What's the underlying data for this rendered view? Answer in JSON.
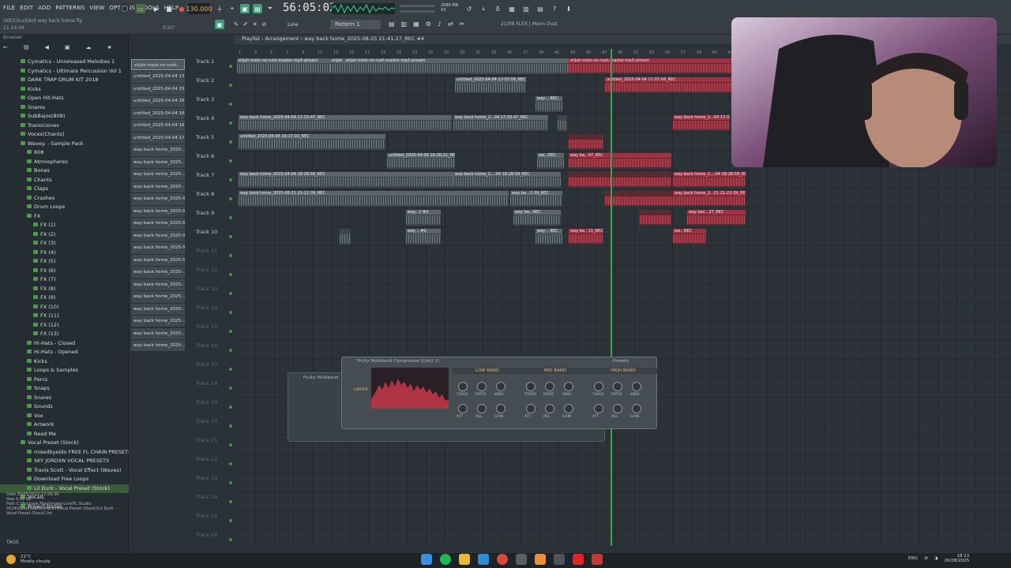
{
  "menu": {
    "items": [
      "FILE",
      "EDIT",
      "ADD",
      "PATTERNS",
      "VIEW",
      "OPTIONS",
      "TOOLS",
      "HELP"
    ],
    "hint": "(Alt)Cloud|Aid way back home.flp",
    "hint_time": "11:14:06",
    "position": "0'20\""
  },
  "transport": {
    "tempo": "130.000",
    "time": "56:05:03",
    "cpu_line1": "2689 MB",
    "cpu_line2": "43",
    "pattern": "Pattern 1",
    "plugin_info": "21/08  FLEX | Moon Dust",
    "snap": "Line"
  },
  "browser": {
    "header": "Browser",
    "items": [
      {
        "label": "Cymatics - Unreleased Melodies 1",
        "indent": 0
      },
      {
        "label": "Cymatics - Ultimate Percussion Vol 1",
        "indent": 0
      },
      {
        "label": "DARK TRAP DRUM KIT 2018",
        "indent": 0
      },
      {
        "label": "Kicks",
        "indent": 0
      },
      {
        "label": "Open Hit-Hats",
        "indent": 0
      },
      {
        "label": "Snares",
        "indent": 0
      },
      {
        "label": "SubBajos(808)",
        "indent": 0
      },
      {
        "label": "Transiciones",
        "indent": 0
      },
      {
        "label": "Voces(Chants)",
        "indent": 0
      },
      {
        "label": "Wavey. - Sample Pack",
        "indent": 0
      },
      {
        "label": "808",
        "indent": 1
      },
      {
        "label": "Atmospheres",
        "indent": 1
      },
      {
        "label": "Bones",
        "indent": 1
      },
      {
        "label": "Chants",
        "indent": 1
      },
      {
        "label": "Claps",
        "indent": 1
      },
      {
        "label": "Crashes",
        "indent": 1
      },
      {
        "label": "Drum Loops",
        "indent": 1
      },
      {
        "label": "FX",
        "indent": 1
      },
      {
        "label": "FX (1)",
        "indent": 2
      },
      {
        "label": "FX (2)",
        "indent": 2
      },
      {
        "label": "FX (3)",
        "indent": 2
      },
      {
        "label": "FX (4)",
        "indent": 2
      },
      {
        "label": "FX (5)",
        "indent": 2
      },
      {
        "label": "FX (6)",
        "indent": 2
      },
      {
        "label": "FX (7)",
        "indent": 2
      },
      {
        "label": "FX (8)",
        "indent": 2
      },
      {
        "label": "FX (9)",
        "indent": 2
      },
      {
        "label": "FX (10)",
        "indent": 2
      },
      {
        "label": "FX (11)",
        "indent": 2
      },
      {
        "label": "FX (12)",
        "indent": 2
      },
      {
        "label": "FX (13)",
        "indent": 2
      },
      {
        "label": "Hi-Hats - Closed",
        "indent": 1
      },
      {
        "label": "Hi-Hats - Opened",
        "indent": 1
      },
      {
        "label": "Kicks",
        "indent": 1
      },
      {
        "label": "Loops & Samples",
        "indent": 1
      },
      {
        "label": "Percs",
        "indent": 1
      },
      {
        "label": "Snaps",
        "indent": 1
      },
      {
        "label": "Snares",
        "indent": 1
      },
      {
        "label": "Sounds",
        "indent": 1
      },
      {
        "label": "Vox",
        "indent": 1
      },
      {
        "label": "Artwork",
        "indent": 1
      },
      {
        "label": "Read Me",
        "indent": 1
      },
      {
        "label": "Vocal Preset (Stock)",
        "indent": 0
      },
      {
        "label": "misedbyeldo FREE FL CHAIN PRESETS VOL. 2",
        "indent": 1
      },
      {
        "label": "SKY JORDXN VOCAL PRESETS",
        "indent": 1
      },
      {
        "label": "Travis Scott - Vocal Effect (Waves)",
        "indent": 1
      },
      {
        "label": "Download Free Loops",
        "indent": 1
      },
      {
        "label": "Lil Durk - Vocal Preset (Stock)",
        "indent": 1
      },
      {
        "label": "Vocals",
        "indent": 0
      },
      {
        "label": "Project bones",
        "indent": 0
      }
    ],
    "info": [
      "Date   30/05/2022 17:29:36",
      "Size   4.59 KB",
      "Path   C:\\Program Files\\Image-Line\\FL Studio 2024\\Data\\Patches\\Packs\\Vocal Preset (Stock)\\Lil Durk - Vocal Preset (Stock).fst"
    ],
    "tags": "TAGS"
  },
  "picker": [
    "elijah-melo-no-rush..",
    "untitled_2025-04-04 15..",
    "untitled_2025-04-04 15..",
    "untitled_2025-04-04 16..",
    "untitled_2025-04-04 16..",
    "untitled_2025-04-04 16..",
    "untitled_2025-04-04 17..",
    "way back home_2025-..",
    "way back home_2025-..",
    "way back home_2025-..",
    "way back home_2025-..",
    "way back home_2025-08..",
    "way back home_2025-08..",
    "way back home_2025-08..",
    "way back home_2025-08..",
    "way back home_2025-08..",
    "way back home_2025-08..",
    "way back home_2025-..",
    "way back home_2025-..",
    "way back home_2025-..",
    "way back home_2025-..",
    "way back home_2025-..",
    "way back home_2025-..",
    "way back home_2025-.."
  ],
  "playlist": {
    "title": "Playlist - Arrangement › way back home_2025-08-25 21-41-27_REC #4",
    "tracks": [
      "Track 1",
      "Track 2",
      "Track 3",
      "Track 4",
      "Track 5",
      "Track 6",
      "Track 7",
      "Track 8",
      "Track 9",
      "Track 10",
      "Track 11",
      "Track 12",
      "Track 13",
      "Track 14",
      "Track 15",
      "Track 16",
      "Track 17",
      "Track 18",
      "Track 19",
      "Track 20",
      "Track 21",
      "Track 22",
      "Track 23",
      "Track 24",
      "Track 25",
      "Track 26"
    ],
    "ruler": [
      "1",
      "3",
      "5",
      "7",
      "9",
      "11",
      "13",
      "15",
      "17",
      "19",
      "21",
      "23",
      "25",
      "27",
      "29",
      "31",
      "33",
      "35",
      "37",
      "39",
      "41",
      "43",
      "45",
      "47",
      "49",
      "51",
      "53",
      "55",
      "57",
      "59",
      "61",
      "63"
    ],
    "clips": [
      {
        "track": 0,
        "start": 0,
        "len": 118,
        "label": "elijah-melo-no-rush-master-mp3-stream",
        "color": "g"
      },
      {
        "track": 0,
        "start": 118,
        "len": 18,
        "label": "elijah - stream",
        "color": "g"
      },
      {
        "track": 0,
        "start": 136,
        "len": 284,
        "label": "elijah-melo-no-rush-master-mp3-stream",
        "color": "g"
      },
      {
        "track": 0,
        "start": 420,
        "len": 210,
        "label": "elijah-melo-no-rush-master-mp3-stream",
        "color": "r"
      },
      {
        "track": 1,
        "start": 276,
        "len": 90,
        "label": "untitled_2025-04-04 17-07-56_REC",
        "color": "g"
      },
      {
        "track": 1,
        "start": 466,
        "len": 160,
        "label": "untitled_2025-04-04 17-07-56_REC",
        "color": "r"
      },
      {
        "track": 2,
        "start": 378,
        "len": 34,
        "label": "way .. REC",
        "color": "g"
      },
      {
        "track": 3,
        "start": 2,
        "len": 270,
        "label": "way back home_2025-04-04 17-33-47_REC",
        "color": "g"
      },
      {
        "track": 3,
        "start": 274,
        "len": 120,
        "label": "way back home_2...04 17-33-47_REC",
        "color": "g"
      },
      {
        "track": 3,
        "start": 406,
        "len": 12,
        "label": "",
        "color": "g"
      },
      {
        "track": 3,
        "start": 552,
        "len": 72,
        "label": "way back home_2...04 17-33",
        "color": "r"
      },
      {
        "track": 4,
        "start": 2,
        "len": 186,
        "label": "untitled_2025-04-04 16-17-02_REC",
        "color": "g"
      },
      {
        "track": 4,
        "start": 420,
        "len": 44,
        "label": "",
        "color": "r"
      },
      {
        "track": 5,
        "start": 190,
        "len": 86,
        "label": "untitled_2025-04-04 16-26-21_REC",
        "color": "g"
      },
      {
        "track": 5,
        "start": 380,
        "len": 34,
        "label": "wa.. REC",
        "color": "g"
      },
      {
        "track": 5,
        "start": 420,
        "len": 130,
        "label": "way ba.. 07_REC",
        "color": "r"
      },
      {
        "track": 6,
        "start": 2,
        "len": 272,
        "label": "way back home_2025-04-04 18-28-58_REC",
        "color": "g"
      },
      {
        "track": 6,
        "start": 274,
        "len": 136,
        "label": "way back home_2...-04 18-28-58_REC",
        "color": "g"
      },
      {
        "track": 6,
        "start": 420,
        "len": 130,
        "label": "",
        "color": "r"
      },
      {
        "track": 6,
        "start": 552,
        "len": 92,
        "label": "way back home_2...-04 18-28-58_REC",
        "color": "r"
      },
      {
        "track": 7,
        "start": 2,
        "len": 342,
        "label": "way back home_2025-08-21 21-22-39_REC",
        "color": "g"
      },
      {
        "track": 7,
        "start": 346,
        "len": 66,
        "label": "way ba.. 2-39_REC",
        "color": "g"
      },
      {
        "track": 7,
        "start": 466,
        "len": 86,
        "label": "",
        "color": "r"
      },
      {
        "track": 7,
        "start": 552,
        "len": 92,
        "label": "way back home_2...21 21-22-39_REC",
        "color": "r"
      },
      {
        "track": 8,
        "start": 214,
        "len": 44,
        "label": "way.. 2 #2",
        "color": "g"
      },
      {
        "track": 8,
        "start": 350,
        "len": 60,
        "label": "way ba.. REC",
        "color": "g"
      },
      {
        "track": 8,
        "start": 510,
        "len": 40,
        "label": "",
        "color": "r"
      },
      {
        "track": 8,
        "start": 570,
        "len": 74,
        "label": "way bac.. 27_REC",
        "color": "r"
      },
      {
        "track": 9,
        "start": 130,
        "len": 14,
        "label": "",
        "color": "g"
      },
      {
        "track": 9,
        "start": 214,
        "len": 44,
        "label": "way .. #2",
        "color": "g"
      },
      {
        "track": 9,
        "start": 378,
        "len": 34,
        "label": "way .. REC",
        "color": "g"
      },
      {
        "track": 9,
        "start": 420,
        "len": 44,
        "label": "way ba.. 11_REC",
        "color": "r"
      },
      {
        "track": 9,
        "start": 552,
        "len": 42,
        "label": "wa.. REC",
        "color": "r"
      }
    ]
  },
  "fx": {
    "mixer_title": "Fruity Multiband",
    "plugin_title": "Fruity Multiband Compressor (Limit 1)",
    "presets": "Presets",
    "limiter": "LIMITER",
    "bands": [
      "LOW BAND",
      "MID BAND",
      "HIGH BAND"
    ],
    "knobs": [
      "THRES",
      "RATIO",
      "KNEE",
      "ATT",
      "REL",
      "GAIN"
    ]
  },
  "taskbar": {
    "temp": "21°C",
    "weather": "Mostly cloudy",
    "lang": "ENG",
    "time": "18:13",
    "date": "26/08/2025"
  },
  "colors": {
    "accent": "#3da052",
    "clip_green": "#3e474d",
    "clip_red": "#9a3344",
    "tempo": "#e0b06b"
  }
}
